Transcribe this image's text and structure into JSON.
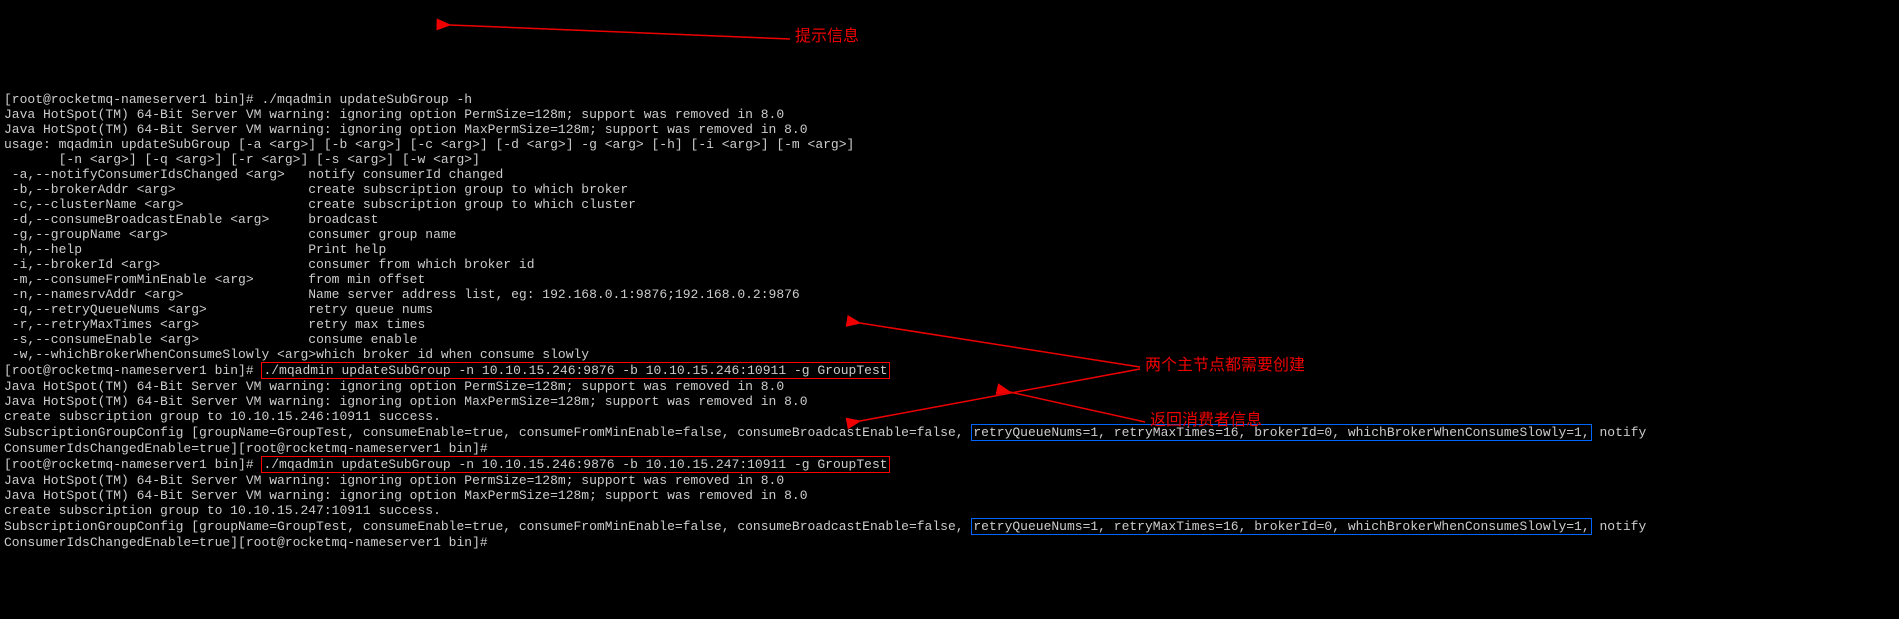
{
  "prompt1": "[root@rocketmq-nameserver1 bin]# ",
  "cmd1": "./mqadmin updateSubGroup -h",
  "warn_perm": "Java HotSpot(TM) 64-Bit Server VM warning: ignoring option PermSize=128m; support was removed in 8.0",
  "warn_maxperm": "Java HotSpot(TM) 64-Bit Server VM warning: ignoring option MaxPermSize=128m; support was removed in 8.0",
  "usage1": "usage: mqadmin updateSubGroup [-a <arg>] [-b <arg>] [-c <arg>] [-d <arg>] -g <arg> [-h] [-i <arg>] [-m <arg>]",
  "usage2": "       [-n <arg>] [-q <arg>] [-r <arg>] [-s <arg>] [-w <arg>]",
  "opts": [
    {
      "flag": " -a,--notifyConsumerIdsChanged <arg>",
      "desc": "   notify consumerId changed"
    },
    {
      "flag": " -b,--brokerAddr <arg>",
      "desc": "                 create subscription group to which broker"
    },
    {
      "flag": " -c,--clusterName <arg>",
      "desc": "                create subscription group to which cluster"
    },
    {
      "flag": " -d,--consumeBroadcastEnable <arg>",
      "desc": "     broadcast"
    },
    {
      "flag": " -g,--groupName <arg>",
      "desc": "                  consumer group name"
    },
    {
      "flag": " -h,--help",
      "desc": "                             Print help"
    },
    {
      "flag": " -i,--brokerId <arg>",
      "desc": "                   consumer from which broker id"
    },
    {
      "flag": " -m,--consumeFromMinEnable <arg>",
      "desc": "       from min offset"
    },
    {
      "flag": " -n,--namesrvAddr <arg>",
      "desc": "                Name server address list, eg: 192.168.0.1:9876;192.168.0.2:9876"
    },
    {
      "flag": " -q,--retryQueueNums <arg>",
      "desc": "             retry queue nums"
    },
    {
      "flag": " -r,--retryMaxTimes <arg>",
      "desc": "              retry max times"
    },
    {
      "flag": " -s,--consumeEnable <arg>",
      "desc": "              consume enable"
    },
    {
      "flag": " -w,--whichBrokerWhenConsumeSlowly <arg>",
      "desc": "which broker id when consume slowly"
    }
  ],
  "prompt2": "[root@rocketmq-nameserver1 bin]# ",
  "cmd2": "./mqadmin updateSubGroup -n 10.10.15.246:9876 -b 10.10.15.246:10911 -g GroupTest",
  "success1": "create subscription group to 10.10.15.246:10911 success.",
  "sub1_a": "SubscriptionGroupConfig [groupName=GroupTest, consumeEnable=true, consumeFromMinEnable=false, consumeBroadcastEnable=false, ",
  "sub1_box": "retryQueueNums=1, retryMaxTimes=16, brokerId=0, whichBrokerWhenConsumeSlowly=1,",
  "sub1_b": " notify",
  "sub1_c": "ConsumerIdsChangedEnable=true]",
  "prompt3": "[root@rocketmq-nameserver1 bin]#",
  "prompt4": "[root@rocketmq-nameserver1 bin]# ",
  "cmd3": "./mqadmin updateSubGroup -n 10.10.15.246:9876 -b 10.10.15.247:10911 -g GroupTest",
  "success2": "create subscription group to 10.10.15.247:10911 success.",
  "sub2_a": "SubscriptionGroupConfig [groupName=GroupTest, consumeEnable=true, consumeFromMinEnable=false, consumeBroadcastEnable=false, ",
  "sub2_box": "retryQueueNums=1, retryMaxTimes=16, brokerId=0, whichBrokerWhenConsumeSlowly=1,",
  "sub2_b": " notify",
  "sub2_c": "ConsumerIdsChangedEnable=true]",
  "prompt5": "[root@rocketmq-nameserver1 bin]#",
  "annot1": "提示信息",
  "annot2": "两个主节点都需要创建",
  "annot3": "返回消费者信息"
}
